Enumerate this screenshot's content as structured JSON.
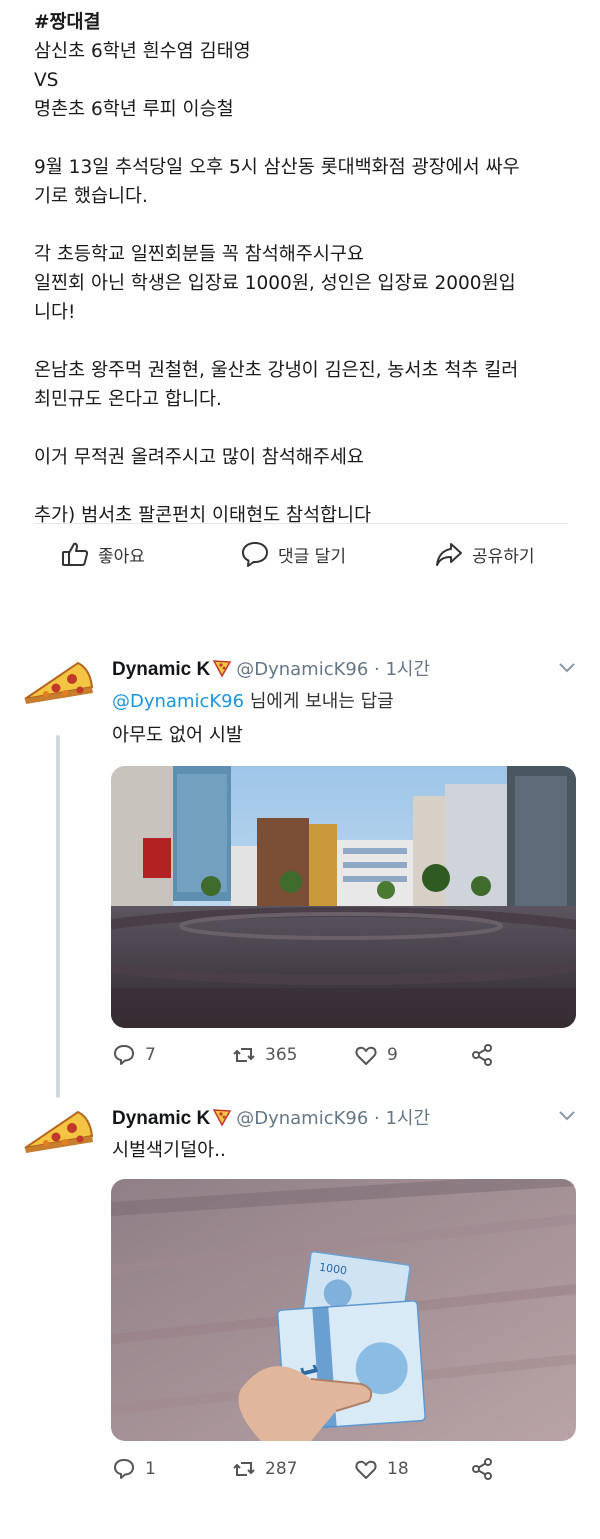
{
  "post": {
    "lines": [
      "#짱대결",
      "삼신초 6학년 흰수염 김태영",
      "VS",
      "명촌초 6학년 루피 이승철",
      "",
      "9월 13일 추석당일 오후 5시 삼산동 롯대백화점 광장에서 싸우",
      "기로 했습니다.",
      "",
      "각 초등학교 일찐회분들 꼭 참석해주시구요",
      "일찐회 아닌 학생은 입장료 1000원, 성인은 입장료 2000원입",
      "니다!",
      "",
      "온남초 왕주먹 권철현, 울산초 강냉이 김은진, 농서초 척추 킬러",
      "최민규도 온다고 합니다.",
      "",
      "이거 무적권 올려주시고 많이 참석해주세요",
      "",
      "추가) 범서초 팔콘펀치 이태현도 참석합니다"
    ]
  },
  "actions": {
    "like": "좋아요",
    "comment": "댓글 달기",
    "share": "공유하기"
  },
  "tweets": [
    {
      "name": "Dynamic K",
      "handle": "@DynamicK96",
      "time": "· 1시간",
      "reply_handle": "@DynamicK96",
      "reply_suffix": " 님에게 보내는 답글",
      "text": "아무도 없어 시발",
      "replies": "7",
      "retweets": "365",
      "likes": "9"
    },
    {
      "name": "Dynamic K",
      "handle": "@DynamicK96",
      "time": "· 1시간",
      "text": "시벌색기덜아..",
      "replies": "1",
      "retweets": "287",
      "likes": "18",
      "banknote_label": "1000"
    }
  ],
  "colors": {
    "link": "#1b95e0",
    "muted": "#657786",
    "thread_line": "#cfd9de"
  },
  "icons": [
    "thumbs-up-icon",
    "speech-bubble-icon",
    "share-arrow-icon",
    "pizza-avatar-icon",
    "pizza-emoji-icon",
    "chevron-down-icon",
    "reply-icon",
    "retweet-icon",
    "heart-icon",
    "share-nodes-icon"
  ]
}
